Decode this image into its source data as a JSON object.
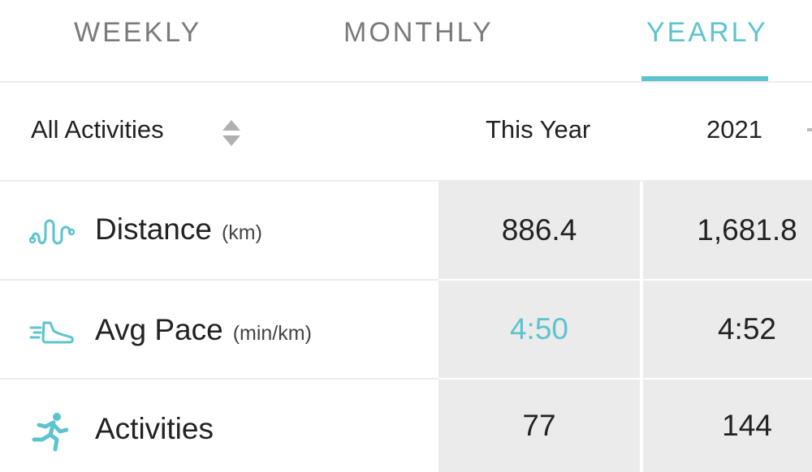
{
  "tabs": [
    {
      "label": "WEEKLY",
      "selected": false
    },
    {
      "label": "MONTHLY",
      "selected": false
    },
    {
      "label": "YEARLY",
      "selected": true
    }
  ],
  "filter": {
    "label": "All Activities",
    "icon": "sort-icon"
  },
  "columns": [
    "This Year",
    "2021"
  ],
  "metrics": [
    {
      "name": "Distance",
      "unit": "(km)",
      "icon": "route-icon",
      "values": [
        "886.4",
        "1,681.8"
      ]
    },
    {
      "name": "Avg Pace",
      "unit": "(min/km)",
      "icon": "shoe-icon",
      "values": [
        "4:50",
        "4:52"
      ],
      "highlight_first": true
    },
    {
      "name": "Activities",
      "unit": "",
      "icon": "runner-icon",
      "values": [
        "77",
        "144"
      ]
    }
  ],
  "colors": {
    "accent": "#5cc3cf",
    "cell_bg": "#ebebeb",
    "text": "#222222",
    "tab_inactive": "#7a7a7a"
  }
}
